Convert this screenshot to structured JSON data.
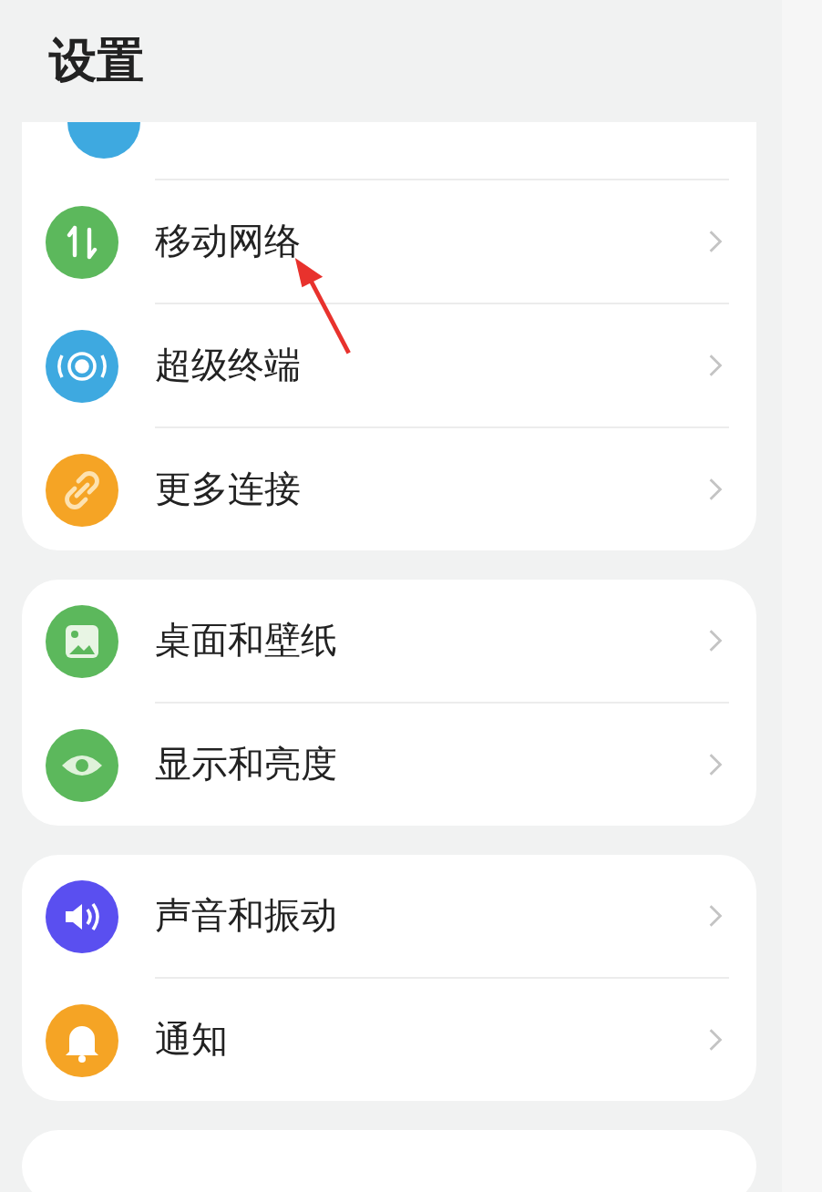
{
  "title": "设置",
  "groups": [
    {
      "cut_row": {
        "color": "#3ea9e0"
      },
      "items": [
        {
          "label": "移动网络",
          "color": "#5cb85c"
        },
        {
          "label": "超级终端",
          "color": "#3ea9e0"
        },
        {
          "label": "更多连接",
          "color": "#f5a425"
        }
      ]
    },
    {
      "items": [
        {
          "label": "桌面和壁纸",
          "color": "#5cb85c"
        },
        {
          "label": "显示和亮度",
          "color": "#5cb85c"
        }
      ]
    },
    {
      "items": [
        {
          "label": "声音和振动",
          "color": "#5a4ff0"
        },
        {
          "label": "通知",
          "color": "#f5a425"
        }
      ]
    }
  ]
}
